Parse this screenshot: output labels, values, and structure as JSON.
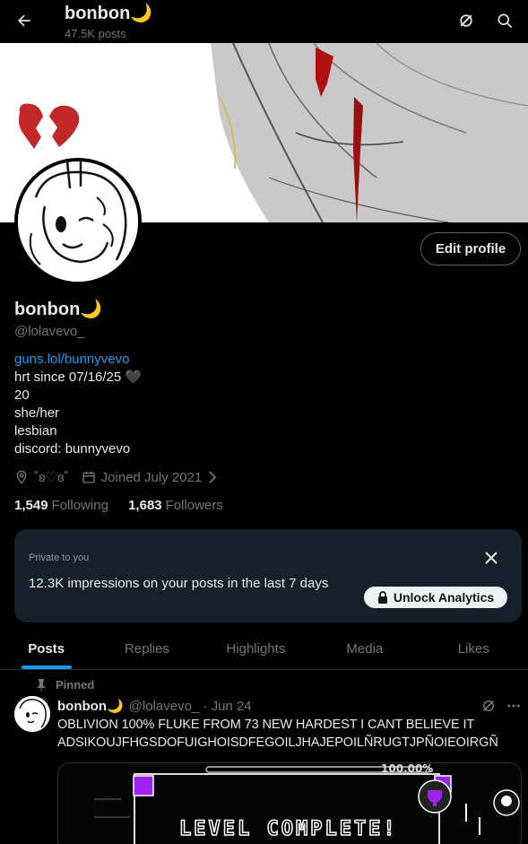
{
  "header": {
    "name": "bonbon🌙",
    "post_count": "47.5K posts"
  },
  "profile": {
    "edit_label": "Edit profile",
    "name": "bonbon🌙",
    "handle": "@lolavevo_",
    "bio_link": "guns.lol/bunnyvevo",
    "bio_lines": [
      "hrt since 07/16/25 🖤",
      "20",
      "she/her",
      "lesbian",
      "discord: bunnyvevo"
    ],
    "location": "˚ʚ♡ɞ˚",
    "joined": "Joined July 2021",
    "following_count": "1,549",
    "following_label": "Following",
    "followers_count": "1,683",
    "followers_label": "Followers"
  },
  "analytics": {
    "private_label": "Private to you",
    "impressions_text": "12.3K impressions on your posts in the last 7 days",
    "unlock_label": "Unlock Analytics"
  },
  "tabs": [
    "Posts",
    "Replies",
    "Highlights",
    "Media",
    "Likes"
  ],
  "pinned_post": {
    "pinned_label": "Pinned",
    "author_name": "bonbon🌙",
    "author_handle": "@lolavevo_ · Jun 24",
    "text_line1": "OBLIVION 100% FLUKE FROM 73 NEW HARDEST I CANT BELIEVE IT",
    "text_line2": "ADSIKOUJFHGSDOFUIGHOISDFEGOILJHAJEPOILÑRUGTJPÑOIEOIRGÑ",
    "media_percent": "100.00%",
    "media_banner": "LEVEL COMPLETE!"
  },
  "colors": {
    "accent": "#1d9bf0",
    "background": "#000000",
    "secondary_text": "#71767b",
    "analytics_card": "#15202b"
  }
}
